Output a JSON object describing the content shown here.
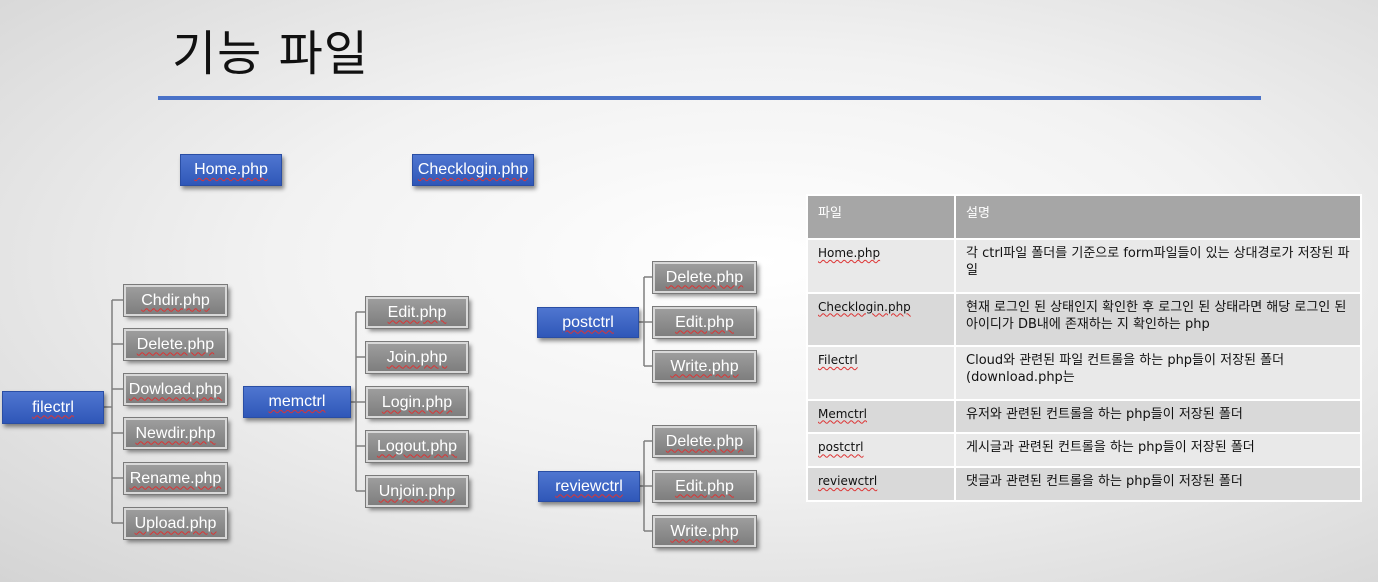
{
  "title": "기능 파일",
  "top_files": [
    "Home.php",
    "Checklogin.php"
  ],
  "folders": {
    "filectrl": {
      "label": "filectrl",
      "files": [
        "Chdir.php",
        "Delete.php",
        "Dowload.php",
        "Newdir.php",
        "Rename.php",
        "Upload.php"
      ]
    },
    "memctrl": {
      "label": "memctrl",
      "files": [
        "Edit.php",
        "Join.php",
        "Login.php",
        "Logout.php",
        "Unjoin.php"
      ]
    },
    "postctrl": {
      "label": "postctrl",
      "files": [
        "Delete.php",
        "Edit.php",
        "Write.php"
      ]
    },
    "reviewctrl": {
      "label": "reviewctrl",
      "files": [
        "Delete.php",
        "Edit.php",
        "Write.php"
      ]
    }
  },
  "table": {
    "headers": [
      "파일",
      "설명"
    ],
    "rows": [
      {
        "file": "Home.php",
        "desc": "각 ctrl파일 폴더를 기준으로 form파일들이 있는 상대경로가 저장된 파일"
      },
      {
        "file": "Checklogin.php",
        "desc": "현재 로그인 된 상태인지 확인한 후 로그인 된 상태라면 해당 로그인 된 아이디가 DB내에 존재하는 지 확인하는 php"
      },
      {
        "file": "Filectrl",
        "desc": "Cloud와 관련된 파일 컨트롤을 하는 php들이 저장된 폴더 (download.php는"
      },
      {
        "file": "Memctrl",
        "desc": "유저와 관련된 컨트롤을 하는 php들이 저장된 폴더"
      },
      {
        "file": "postctrl",
        "desc": "게시글과 관련된 컨트롤을 하는 php들이 저장된 폴더"
      },
      {
        "file": "reviewctrl",
        "desc": "댓글과 관련된 컨트롤을 하는 php들이 저장된 폴더"
      }
    ]
  }
}
